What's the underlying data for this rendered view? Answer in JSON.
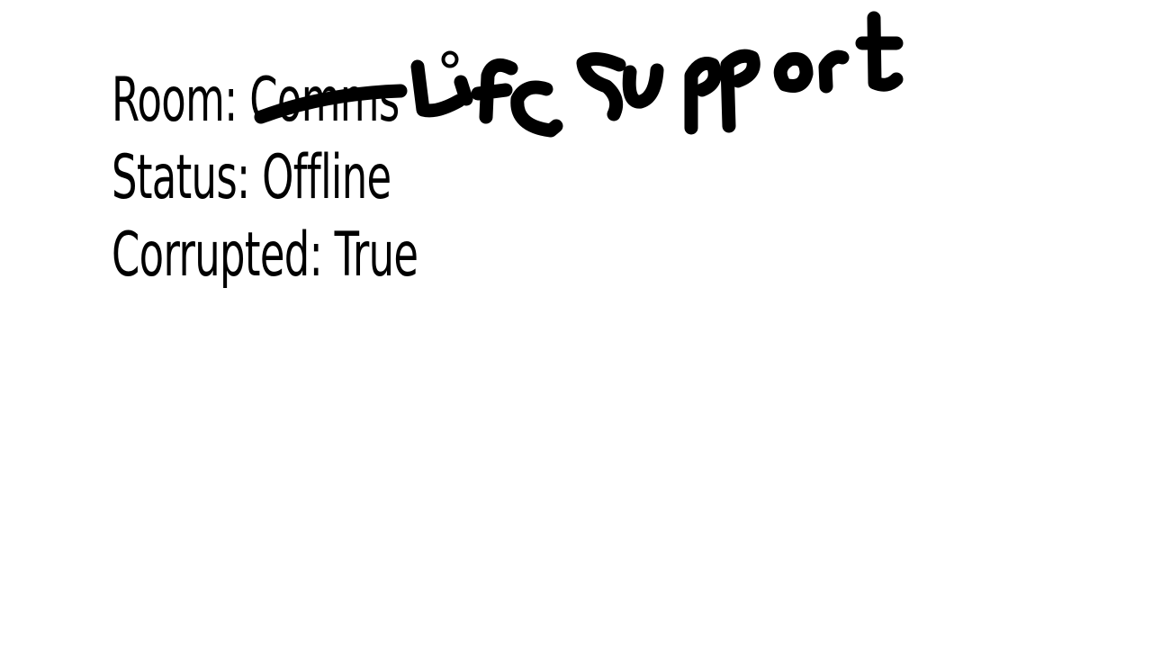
{
  "room": {
    "label": "Room:",
    "original_value": "Comms",
    "handwritten_value": "Life support"
  },
  "status": {
    "label": "Status:",
    "value": "Offline"
  },
  "corrupted": {
    "label": "Corrupted:",
    "value": "True"
  },
  "colors": {
    "text": "#000000",
    "background": "#ffffff",
    "ink": "#000000"
  }
}
